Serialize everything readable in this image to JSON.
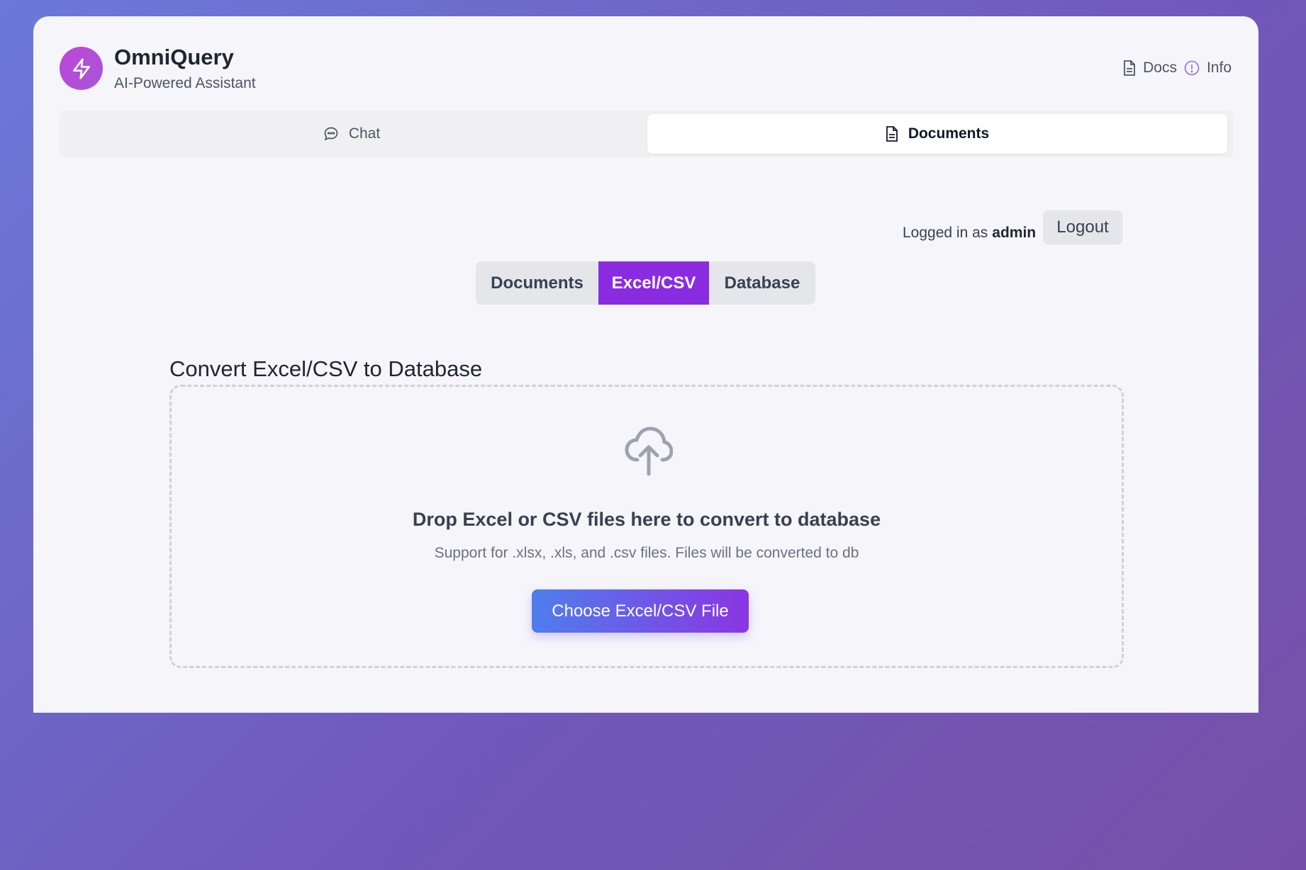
{
  "header": {
    "title": "OmniQuery",
    "subtitle": "AI-Powered Assistant",
    "links": [
      {
        "label": "Docs",
        "icon": "document-icon"
      },
      {
        "label": "Info",
        "icon": "info-icon"
      }
    ]
  },
  "main_tabs": [
    {
      "label": "Chat",
      "icon": "chat-bubble-icon",
      "active": false
    },
    {
      "label": "Documents",
      "icon": "document-icon",
      "active": true
    }
  ],
  "session": {
    "logged_in_prefix": "Logged in as",
    "username": "admin",
    "logout_label": "Logout"
  },
  "sub_tabs": [
    {
      "label": "Documents",
      "active": false
    },
    {
      "label": "Excel/CSV",
      "active": true
    },
    {
      "label": "Database",
      "active": false
    }
  ],
  "upload": {
    "section_title": "Convert Excel/CSV to Database",
    "drop_title": "Drop Excel or CSV files here to convert to database",
    "drop_subtitle": "Support for .xlsx, .xls, and .csv files. Files will be converted to db",
    "button_label": "Choose Excel/CSV File",
    "icon": "cloud-upload-icon"
  },
  "colors": {
    "accent": "#8a2be2",
    "button_gradient_start": "#4f7eec",
    "button_gradient_end": "#8a36e2",
    "logo_gradient_start": "#c044d7",
    "logo_gradient_end": "#a557d9"
  }
}
